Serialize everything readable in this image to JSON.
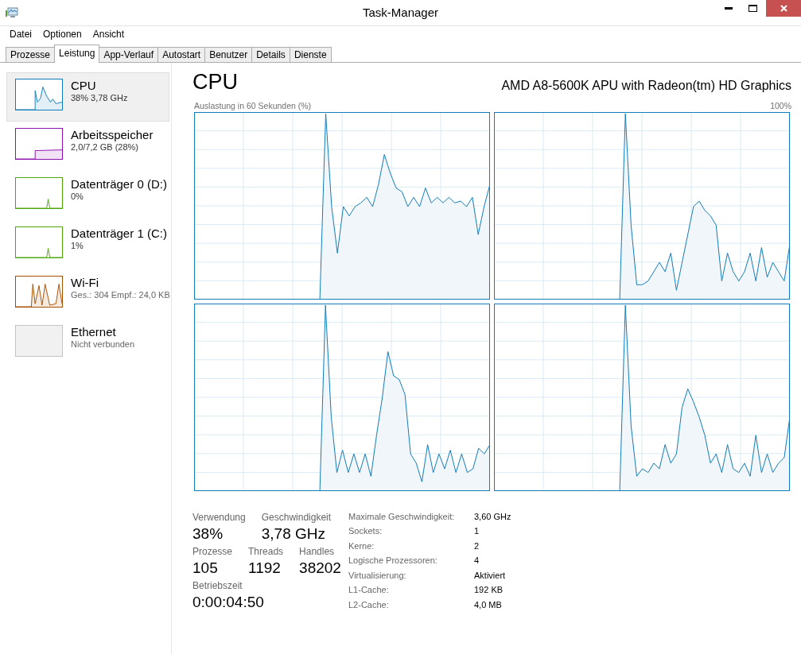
{
  "window": {
    "title": "Task-Manager"
  },
  "menu": [
    "Datei",
    "Optionen",
    "Ansicht"
  ],
  "tabs": [
    {
      "label": "Prozesse",
      "selected": false
    },
    {
      "label": "Leistung",
      "selected": true
    },
    {
      "label": "App-Verlauf",
      "selected": false
    },
    {
      "label": "Autostart",
      "selected": false
    },
    {
      "label": "Benutzer",
      "selected": false
    },
    {
      "label": "Details",
      "selected": false
    },
    {
      "label": "Dienste",
      "selected": false
    }
  ],
  "sidebar": {
    "items": [
      {
        "kind": "cpu",
        "title": "CPU",
        "subtitle": "38% 3,78 GHz",
        "color": "#117dbb",
        "selected": true
      },
      {
        "kind": "memory",
        "title": "Arbeitsspeicher",
        "subtitle": "2,0/7,2 GB (28%)",
        "color": "#8b12ae",
        "selected": false
      },
      {
        "kind": "disk",
        "title": "Datenträger 0 (D:)",
        "subtitle": "0%",
        "color": "#4da60c",
        "selected": false
      },
      {
        "kind": "disk",
        "title": "Datenträger 1 (C:)",
        "subtitle": "1%",
        "color": "#4da60c",
        "selected": false
      },
      {
        "kind": "network",
        "title": "Wi-Fi",
        "subtitle": "Ges.: 304 Empf.: 24,0 KB",
        "color": "#a74f01",
        "selected": false
      },
      {
        "kind": "none",
        "title": "Ethernet",
        "subtitle": "Nicht verbunden",
        "color": "#c4c4c4",
        "selected": false
      }
    ]
  },
  "main": {
    "title": "CPU",
    "model": "AMD A8-5600K APU with Radeon(tm) HD Graphics",
    "graph_label": "Auslastung in 60 Sekunden (%)",
    "graph_max": "100%",
    "stats": [
      [
        {
          "label": "Verwendung",
          "value": "38%"
        },
        {
          "label": "Geschwindigkeit",
          "value": "3,78 GHz"
        }
      ],
      [
        {
          "label": "Prozesse",
          "value": "105"
        },
        {
          "label": "Threads",
          "value": "1192"
        },
        {
          "label": "Handles",
          "value": "38202"
        }
      ],
      [
        {
          "label": "Betriebszeit",
          "value": "0:00:04:50"
        }
      ]
    ],
    "details": [
      {
        "label": "Maximale Geschwindigkeit:",
        "value": "3,60 GHz"
      },
      {
        "label": "Sockets:",
        "value": "1"
      },
      {
        "label": "Kerne:",
        "value": "2"
      },
      {
        "label": "Logische Prozessoren:",
        "value": "4"
      },
      {
        "label": "Virtualisierung:",
        "value": "Aktiviert"
      },
      {
        "label": "L1-Cache:",
        "value": "192 KB"
      },
      {
        "label": "L2-Cache:",
        "value": "4,0 MB"
      }
    ]
  }
}
